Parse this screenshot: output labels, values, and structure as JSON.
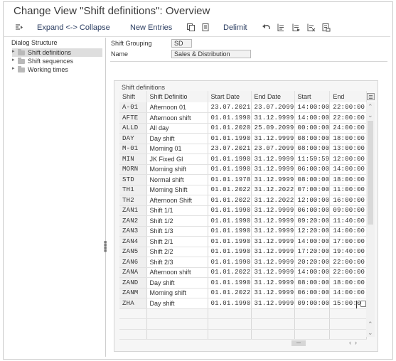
{
  "window": {
    "title": "Change View \"Shift definitions\": Overview"
  },
  "toolbar": {
    "expand_collapse": "Expand <-> Collapse",
    "new_entries": "New Entries",
    "delimit": "Delimit"
  },
  "dialog": {
    "title": "Dialog Structure",
    "items": [
      {
        "label": "Shift definitions",
        "selected": true
      },
      {
        "label": "Shift sequences",
        "selected": false
      },
      {
        "label": "Working times",
        "selected": false
      }
    ]
  },
  "header": {
    "shift_grouping_label": "Shift Grouping",
    "shift_grouping_value": "SD",
    "name_label": "Name",
    "name_value": "Sales & Distribution"
  },
  "table": {
    "group_title": "Shift definitions",
    "columns": [
      "Shift",
      "Shift Definitio",
      "Start Date",
      "End Date",
      "Start",
      "End"
    ],
    "rows": [
      [
        "A-01",
        "Afternoon 01",
        "23.07.2021",
        "23.07.2099",
        "14:00:00",
        "22:00:00"
      ],
      [
        "AFTE",
        "Afternoon shift",
        "01.01.1990",
        "31.12.9999",
        "14:00:00",
        "22:00:00"
      ],
      [
        "ALLD",
        "All day",
        "01.01.2020",
        "25.09.2099",
        "00:00:00",
        "24:00:00"
      ],
      [
        "DAY",
        "Day shift",
        "01.01.1990",
        "31.12.9999",
        "08:00:00",
        "18:00:00"
      ],
      [
        "M-01",
        "Morning 01",
        "23.07.2021",
        "23.07.2099",
        "08:00:00",
        "13:00:00"
      ],
      [
        "MIN",
        "JK Fixed GI",
        "01.01.1990",
        "31.12.9999",
        "11:59:59",
        "12:00:00"
      ],
      [
        "MORN",
        "Morning shift",
        "01.01.1990",
        "31.12.9999",
        "06:00:00",
        "14:00:00"
      ],
      [
        "STD",
        "Normal shift",
        "01.01.1978",
        "31.12.9999",
        "08:00:00",
        "18:00:00"
      ],
      [
        "TH1",
        "Morning Shift",
        "01.01.2022",
        "31.12.2022",
        "07:00:00",
        "11:00:00"
      ],
      [
        "TH2",
        "Afternoon Shift",
        "01.01.2022",
        "31.12.2022",
        "12:00:00",
        "16:00:00"
      ],
      [
        "ZAN1",
        "Shift 1/1",
        "01.01.1990",
        "31.12.9999",
        "06:00:00",
        "09:00:00"
      ],
      [
        "ZAN2",
        "Shift 1/2",
        "01.01.1990",
        "31.12.9999",
        "09:20:00",
        "11:40:00"
      ],
      [
        "ZAN3",
        "Shift 1/3",
        "01.01.1990",
        "31.12.9999",
        "12:20:00",
        "14:00:00"
      ],
      [
        "ZAN4",
        "Shift 2/1",
        "01.01.1990",
        "31.12.9999",
        "14:00:00",
        "17:00:00"
      ],
      [
        "ZAN5",
        "Shift 2/2",
        "01.01.1990",
        "31.12.9999",
        "17:20:00",
        "19:40:00"
      ],
      [
        "ZAN6",
        "Shift 2/3",
        "01.01.1990",
        "31.12.9999",
        "20:20:00",
        "22:00:00"
      ],
      [
        "ZANA",
        "Afternoon shift",
        "01.01.2022",
        "31.12.9999",
        "14:00:00",
        "22:00:00"
      ],
      [
        "ZAND",
        "Day shift",
        "01.01.1990",
        "31.12.9999",
        "08:00:00",
        "18:00:00"
      ],
      [
        "ZANM",
        "Morning shift",
        "01.01.2022",
        "31.12.9999",
        "06:00:00",
        "14:00:00"
      ],
      [
        "ZHA",
        "Day shift",
        "01.01.1990",
        "31.12.9999",
        "09:00:00",
        "15:00:00"
      ]
    ],
    "empty_rows": 3
  },
  "icons": {
    "expand": "expand-collapse-icon",
    "copy": "copy-icon",
    "save": "save-entries-icon",
    "undo": "undo-icon",
    "select_all": "select-all-icon",
    "select_block": "select-block-icon",
    "deselect": "deselect-icon",
    "print": "print-icon"
  }
}
